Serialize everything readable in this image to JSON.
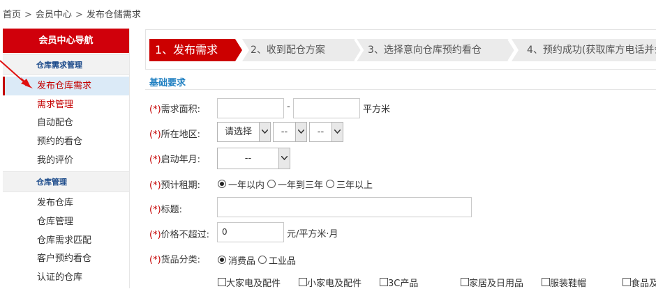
{
  "breadcrumb": {
    "items": [
      "首页",
      "会员中心",
      "发布仓储需求"
    ],
    "separator": ">"
  },
  "sidebar": {
    "title": "会员中心导航",
    "sections": [
      {
        "title": "仓库需求管理",
        "items": [
          "发布仓库需求",
          "需求管理",
          "自动配仓",
          "预约的看仓",
          "我的评价"
        ]
      },
      {
        "title": "仓库管理",
        "items": [
          "发布仓库",
          "仓库管理",
          "仓库需求匹配",
          "客户预约看仓",
          "认证的仓库"
        ]
      }
    ]
  },
  "steps": [
    "1、发布需求",
    "2、收到配仓方案",
    "3、选择意向仓库预约看仓",
    "4、预约成功(获取库方电话并会"
  ],
  "form": {
    "section_title": "基础要求",
    "required_mark": "(*)",
    "area": {
      "label": "需求面积:",
      "dash": "-",
      "unit": "平方米"
    },
    "region": {
      "label": "所在地区:",
      "province": "请选择",
      "city": "--",
      "district": "--"
    },
    "start_year": {
      "label": "启动年月:",
      "value": "--"
    },
    "lease": {
      "label": "预计租期:",
      "options": [
        "一年以内",
        "一年到三年",
        "三年以上"
      ],
      "selected": 0
    },
    "title": {
      "label": "标题:",
      "value": ""
    },
    "price": {
      "label": "价格不超过:",
      "value": "0",
      "unit": "元/平方米·月"
    },
    "category": {
      "label": "货品分类:",
      "options": [
        "消费品",
        "工业品"
      ],
      "selected": 0,
      "sub_items": [
        "大家电及配件",
        "小家电及配件",
        "3C产品",
        "家居及日用品",
        "服装鞋帽",
        "食品及"
      ]
    }
  },
  "colors": {
    "brand_red": "#d0000b",
    "link_blue": "#1f7fc1",
    "active_bg": "#dbeaf7"
  }
}
